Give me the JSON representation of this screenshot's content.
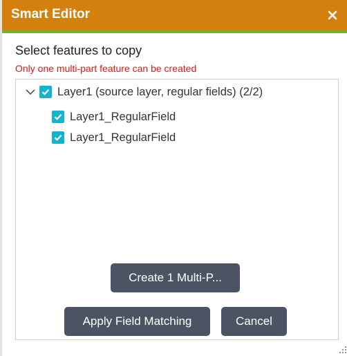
{
  "colors": {
    "title_bar": "#d3800e",
    "title_accent": "#75b22b",
    "checkbox": "#14b4cf",
    "button": "#4c5463",
    "warning": "#ee1111"
  },
  "dialog": {
    "title": "Smart Editor",
    "close_icon": "close-icon"
  },
  "content": {
    "heading": "Select features to copy",
    "warning": "Only one multi-part feature can be created"
  },
  "tree": {
    "root": {
      "label": "Layer1 (source layer, regular fields) (2/2)",
      "expanded": true,
      "checked": true
    },
    "children": [
      {
        "label": "Layer1_RegularField",
        "checked": true
      },
      {
        "label": "Layer1_RegularField",
        "checked": true
      }
    ]
  },
  "buttons": {
    "create": "Create 1 Multi-P...",
    "apply": "Apply Field Matching",
    "cancel": "Cancel"
  }
}
